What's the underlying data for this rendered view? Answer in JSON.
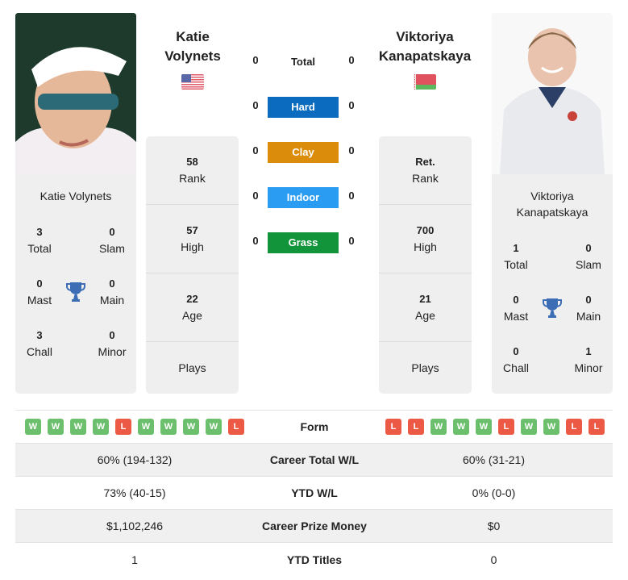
{
  "players": {
    "left": {
      "name": "Katie Volynets",
      "name_line1": "Katie",
      "name_line2": "Volynets",
      "country_flag": "usa-flag",
      "photo": "katie-volynets-photo",
      "titles": {
        "total": {
          "value": "3",
          "label": "Total"
        },
        "slam": {
          "value": "0",
          "label": "Slam"
        },
        "mast": {
          "value": "0",
          "label": "Mast"
        },
        "main": {
          "value": "0",
          "label": "Main"
        },
        "chall": {
          "value": "3",
          "label": "Chall"
        },
        "minor": {
          "value": "0",
          "label": "Minor"
        }
      },
      "stats": {
        "rank": {
          "value": "58",
          "label": "Rank"
        },
        "high": {
          "value": "57",
          "label": "High"
        },
        "age": {
          "value": "22",
          "label": "Age"
        },
        "plays": {
          "value": "",
          "label": "Plays"
        }
      }
    },
    "right": {
      "name": "Viktoriya Kanapatskaya",
      "name_line1": "Viktoriya",
      "name_line2": "Kanapatskaya",
      "country_flag": "belarus-flag",
      "photo": "viktoriya-kanapatskaya-photo",
      "titles": {
        "total": {
          "value": "1",
          "label": "Total"
        },
        "slam": {
          "value": "0",
          "label": "Slam"
        },
        "mast": {
          "value": "0",
          "label": "Mast"
        },
        "main": {
          "value": "0",
          "label": "Main"
        },
        "chall": {
          "value": "0",
          "label": "Chall"
        },
        "minor": {
          "value": "1",
          "label": "Minor"
        }
      },
      "stats": {
        "rank": {
          "value": "Ret.",
          "label": "Rank"
        },
        "high": {
          "value": "700",
          "label": "High"
        },
        "age": {
          "value": "21",
          "label": "Age"
        },
        "plays": {
          "value": "",
          "label": "Plays"
        }
      }
    }
  },
  "h2h": [
    {
      "label": "Total",
      "left": "0",
      "right": "0",
      "color": null
    },
    {
      "label": "Hard",
      "left": "0",
      "right": "0",
      "color": "#0a6bbf"
    },
    {
      "label": "Clay",
      "left": "0",
      "right": "0",
      "color": "#db8c0a"
    },
    {
      "label": "Indoor",
      "left": "0",
      "right": "0",
      "color": "#2a9cf2"
    },
    {
      "label": "Grass",
      "left": "0",
      "right": "0",
      "color": "#12953a"
    }
  ],
  "form": {
    "label": "Form",
    "left": [
      "W",
      "W",
      "W",
      "W",
      "L",
      "W",
      "W",
      "W",
      "W",
      "L"
    ],
    "right": [
      "L",
      "L",
      "W",
      "W",
      "W",
      "L",
      "W",
      "W",
      "L",
      "L"
    ]
  },
  "comparison": [
    {
      "label": "Career Total W/L",
      "left": "60% (194-132)",
      "right": "60% (31-21)"
    },
    {
      "label": "YTD W/L",
      "left": "73% (40-15)",
      "right": "0% (0-0)"
    },
    {
      "label": "Career Prize Money",
      "left": "$1,102,246",
      "right": "$0"
    },
    {
      "label": "YTD Titles",
      "left": "1",
      "right": "0"
    }
  ],
  "colors": {
    "win": "#6cbf6c",
    "loss": "#ec5a45",
    "trophy": "#3d6db5",
    "card_bg": "#efefef"
  }
}
